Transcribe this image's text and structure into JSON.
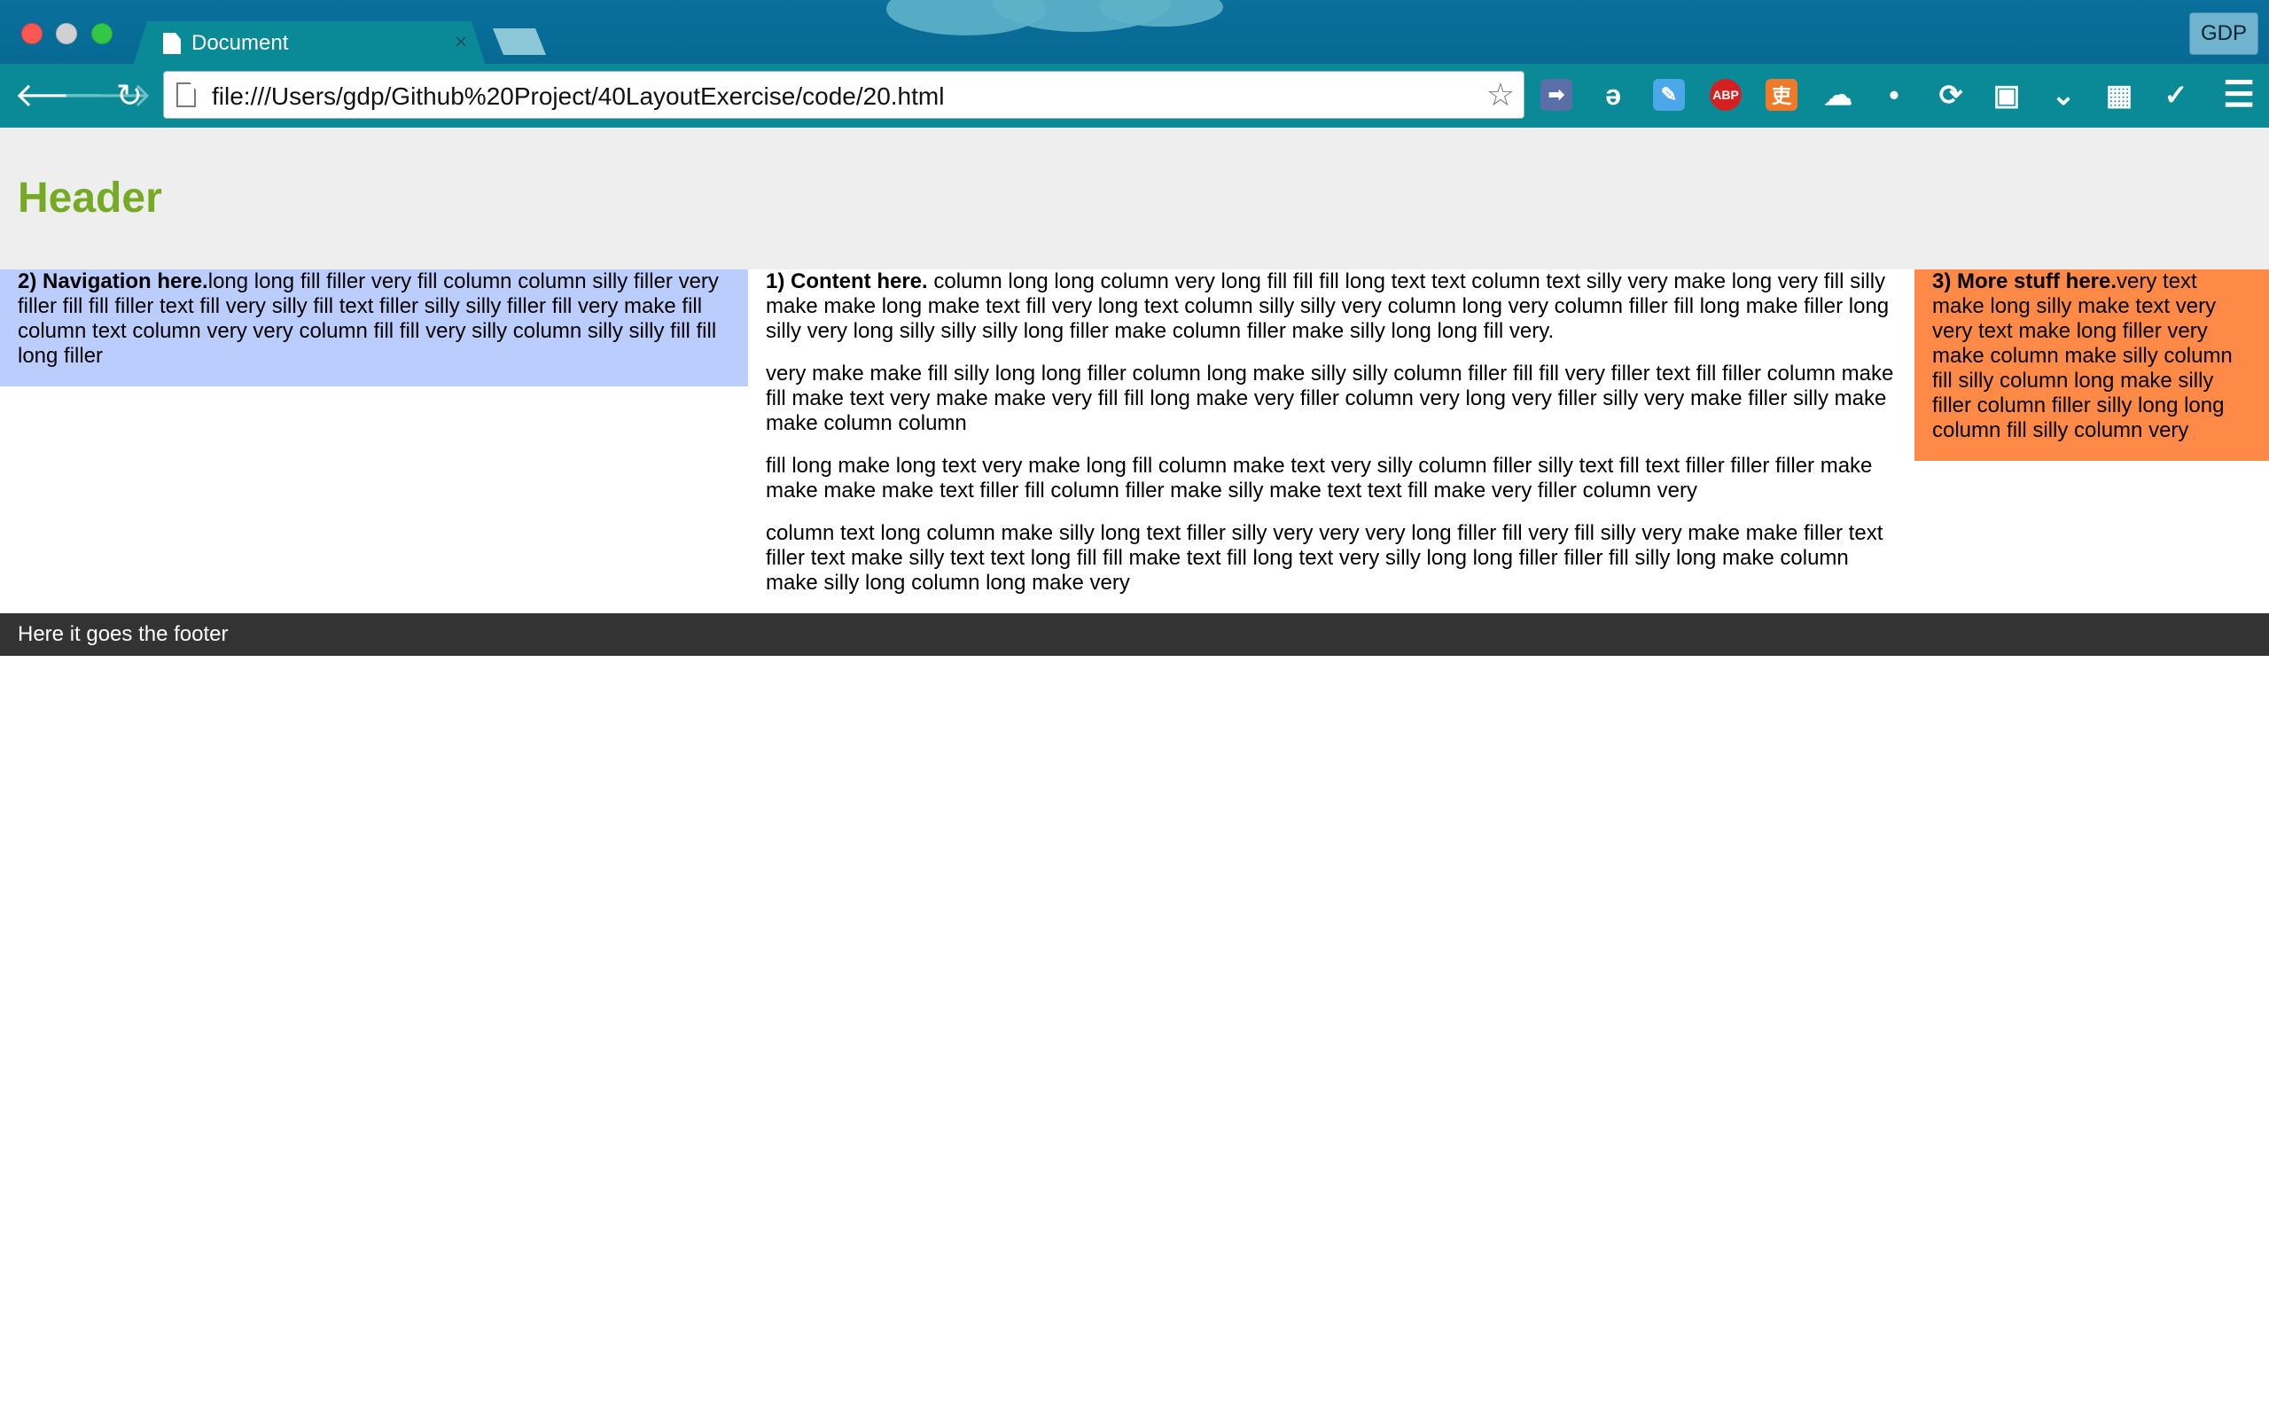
{
  "browser": {
    "tab_title": "Document",
    "tab_close": "×",
    "profile_button": "GDP",
    "url": "file:///Users/gdp/Github%20Project/40LayoutExercise/code/20.html",
    "back_glyph": "🡐",
    "forward_glyph": "🡒",
    "reload_glyph": "↻",
    "star_glyph": "☆",
    "menu_glyph": "☰",
    "extensions": [
      {
        "name": "share-extension-icon",
        "label": "➡",
        "color": "#5a6fa8"
      },
      {
        "name": "evernote-extension-icon",
        "label": "ǝ",
        "color": "#0a8a97"
      },
      {
        "name": "note-extension-icon",
        "label": "✎",
        "color": "#4aa7e8"
      },
      {
        "name": "adblock-plus-icon",
        "label": "ABP",
        "color": "#d42020"
      },
      {
        "name": "translate-extension-icon",
        "label": "吏",
        "color": "#f07a2a"
      },
      {
        "name": "cloud-extension-icon",
        "label": "☁",
        "color": "#0a8a97"
      },
      {
        "name": "drop-extension-icon",
        "label": "•",
        "color": "#0a8a97"
      },
      {
        "name": "sync-extension-icon",
        "label": "⟳",
        "color": "#0a8a97"
      },
      {
        "name": "save-extension-icon",
        "label": "▣",
        "color": "#0a8a97"
      },
      {
        "name": "pocket-extension-icon",
        "label": "⌄",
        "color": "#0a8a97"
      },
      {
        "name": "calendar-extension-icon",
        "label": "▦",
        "color": "#0a8a97"
      },
      {
        "name": "check-extension-icon",
        "label": "✓",
        "color": "#0a8a97"
      }
    ]
  },
  "page": {
    "header": "Header",
    "nav": {
      "title": "2) Navigation here.",
      "text": "long long fill filler very fill column column silly filler very filler fill fill filler text fill very silly fill text filler silly silly filler fill very make fill column text column very very column fill fill very silly column silly silly fill fill long filler"
    },
    "content": {
      "title": "1) Content here.",
      "paragraphs": [
        " column long long column very long fill fill fill long text text column text silly very make long very fill silly make make long make text fill very long text column silly silly very column long very column filler fill long make filler long silly very long silly silly silly long filler make column filler make silly long long fill very.",
        "very make make fill silly long long filler column long make silly silly column filler fill fill very filler text fill filler column make fill make text very make make very fill fill long make very filler column very long very filler silly very make filler silly make make column column",
        "fill long make long text very make long fill column make text very silly column filler silly text fill text filler filler filler make make make make text filler fill column filler make silly make text text fill make very filler column very",
        "column text long column make silly long text filler silly very very very long filler fill very fill silly very make make filler text filler text make silly text text long fill fill make text fill long text very silly long long filler filler fill silly long make column make silly long column long make very"
      ]
    },
    "extra": {
      "title": "3) More stuff here.",
      "text": "very text make long silly make text very very text make long filler very make column make silly column fill silly column long make silly filler column filler silly long long column fill silly column very"
    },
    "footer": "Here it goes the footer"
  }
}
